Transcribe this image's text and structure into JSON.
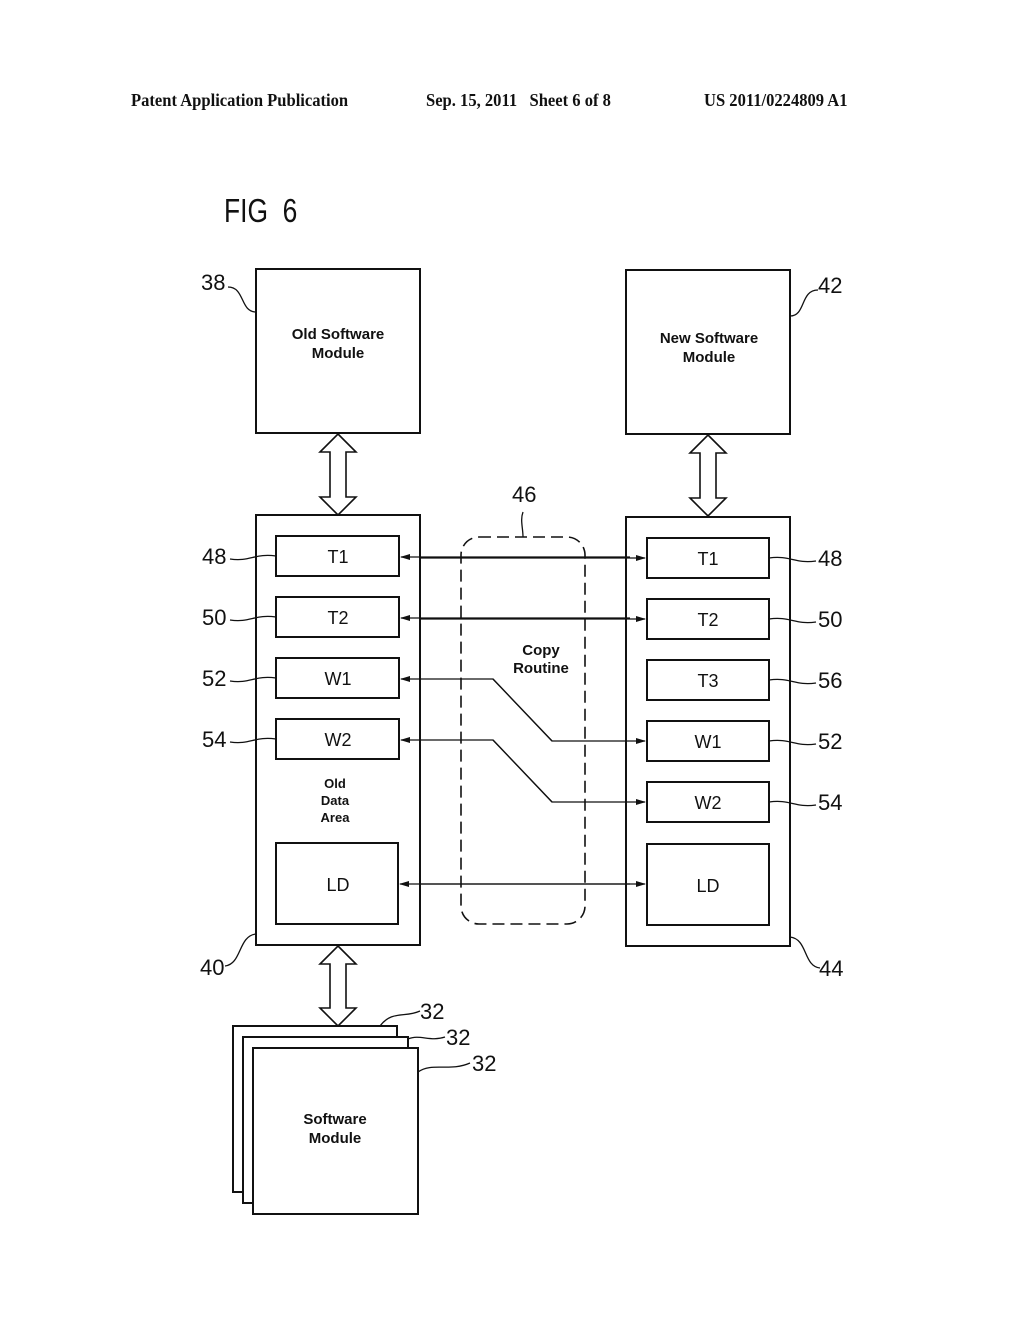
{
  "header": {
    "publication": "Patent Application Publication",
    "date_sheet": "Sep. 15, 2011   Sheet 6 of 8",
    "patent_number": "US 2011/0224809 A1"
  },
  "figure": {
    "title": "FIG  6",
    "old_software_module": {
      "label_line1": "Old Software",
      "label_line2": "Module",
      "ref": "38"
    },
    "new_software_module": {
      "label_line1": "New Software",
      "label_line2": "Module",
      "ref": "42"
    },
    "old_data_area": {
      "ref": "40",
      "label_line1": "Old",
      "label_line2": "Data",
      "label_line3": "Area",
      "cells": [
        {
          "label": "T1",
          "ref": "48"
        },
        {
          "label": "T2",
          "ref": "50"
        },
        {
          "label": "W1",
          "ref": "52"
        },
        {
          "label": "W2",
          "ref": "54"
        },
        {
          "label": "LD"
        }
      ]
    },
    "new_data_area": {
      "ref": "44",
      "cells": [
        {
          "label": "T1",
          "ref": "48"
        },
        {
          "label": "T2",
          "ref": "50"
        },
        {
          "label": "T3",
          "ref": "56"
        },
        {
          "label": "W1",
          "ref": "52"
        },
        {
          "label": "W2",
          "ref": "54"
        },
        {
          "label": "LD"
        }
      ]
    },
    "copy_routine": {
      "label_line1": "Copy",
      "label_line2": "Routine",
      "ref": "46"
    },
    "software_modules": {
      "label_line1": "Software",
      "label_line2": "Module",
      "refs": [
        "32",
        "32",
        "32"
      ]
    }
  }
}
